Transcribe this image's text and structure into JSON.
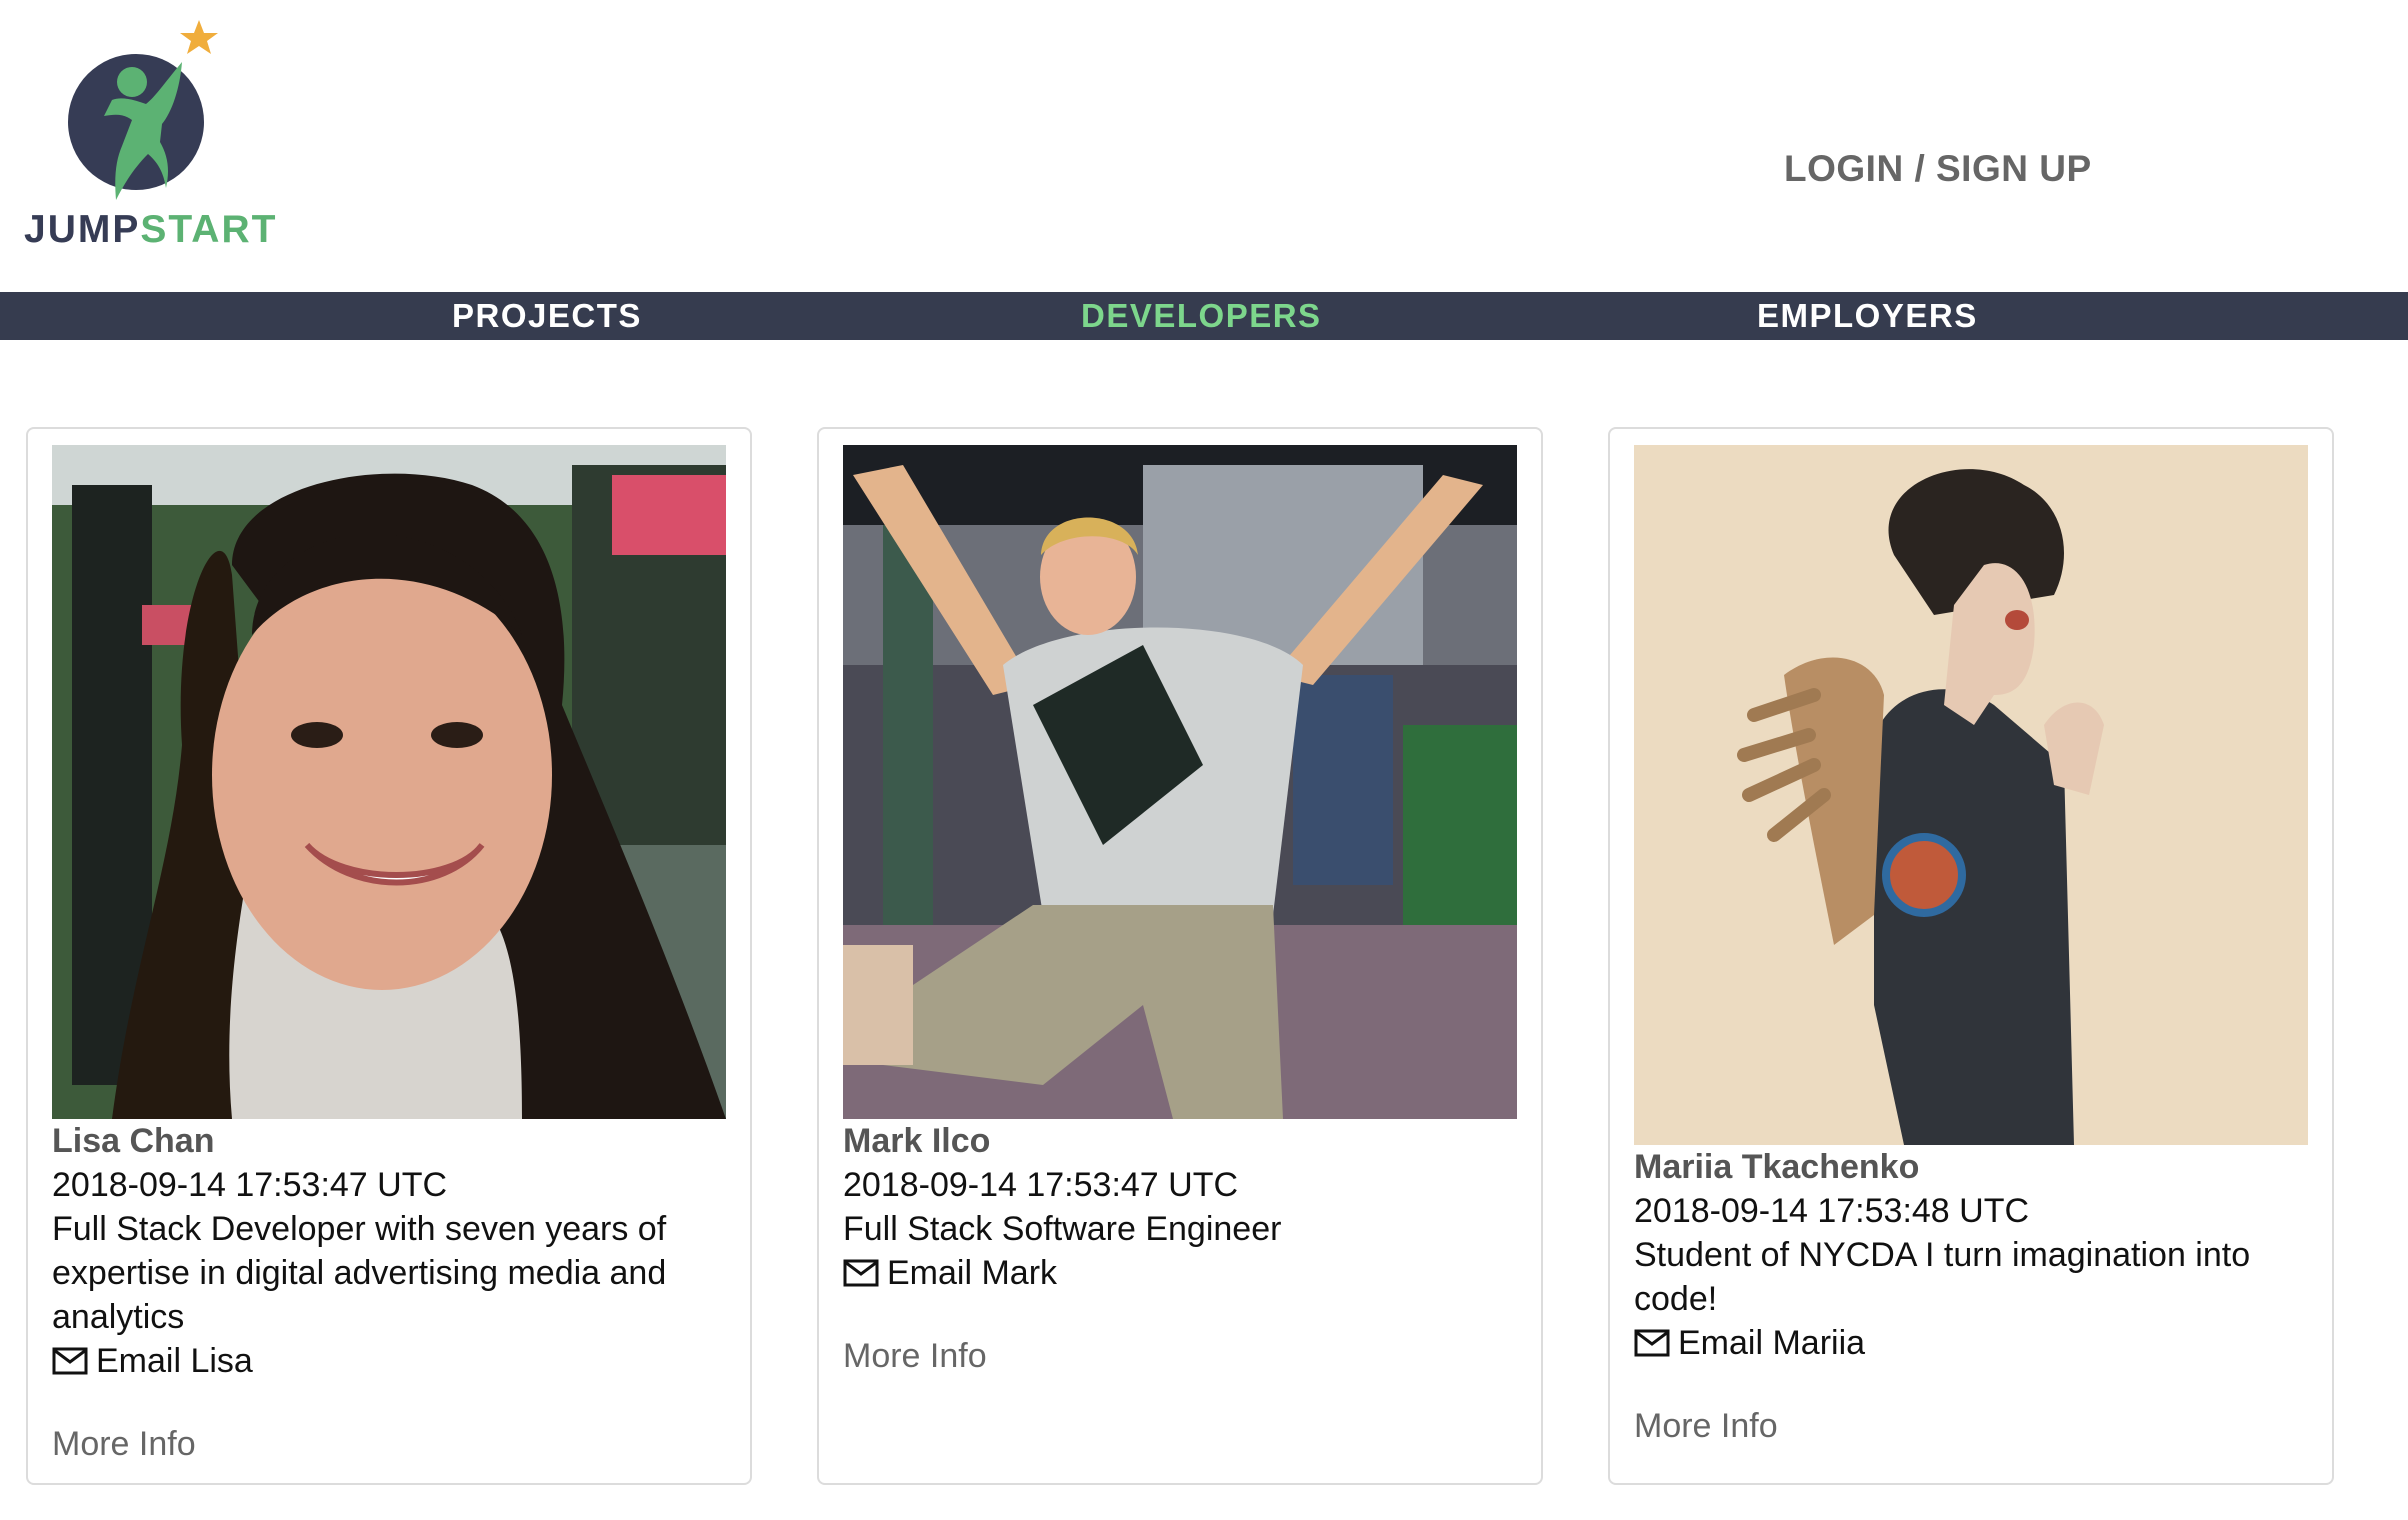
{
  "brand": {
    "name_part1": "JUMP",
    "name_part2": "START"
  },
  "header": {
    "login_label": "LOGIN / SIGN UP"
  },
  "nav": {
    "items": [
      {
        "label": "PROJECTS",
        "active": false
      },
      {
        "label": "DEVELOPERS",
        "active": true
      },
      {
        "label": "EMPLOYERS",
        "active": false
      }
    ]
  },
  "developers": [
    {
      "name": "Lisa Chan",
      "created": "2018-09-14 17:53:47 UTC",
      "bio": "Full Stack Developer with seven years of expertise in digital advertising media and analytics",
      "email_label": "Email Lisa",
      "more_info_label": "More Info"
    },
    {
      "name": "Mark Ilco",
      "created": "2018-09-14 17:53:47 UTC",
      "bio": "Full Stack Software Engineer",
      "email_label": "Email Mark",
      "more_info_label": "More Info"
    },
    {
      "name": "Mariia Tkachenko",
      "created": "2018-09-14 17:53:48 UTC",
      "bio": "Student of NYCDA I turn imagination into code!",
      "email_label": "Email Mariia",
      "more_info_label": "More Info"
    }
  ],
  "colors": {
    "navbar_bg": "#363c4f",
    "nav_active": "#7dd68c",
    "brand_dark": "#363c55",
    "brand_green": "#5cb273",
    "star": "#f0ad3c"
  },
  "icons": {
    "email": "envelope-icon",
    "logo": "jumpstart-star-person-logo"
  }
}
